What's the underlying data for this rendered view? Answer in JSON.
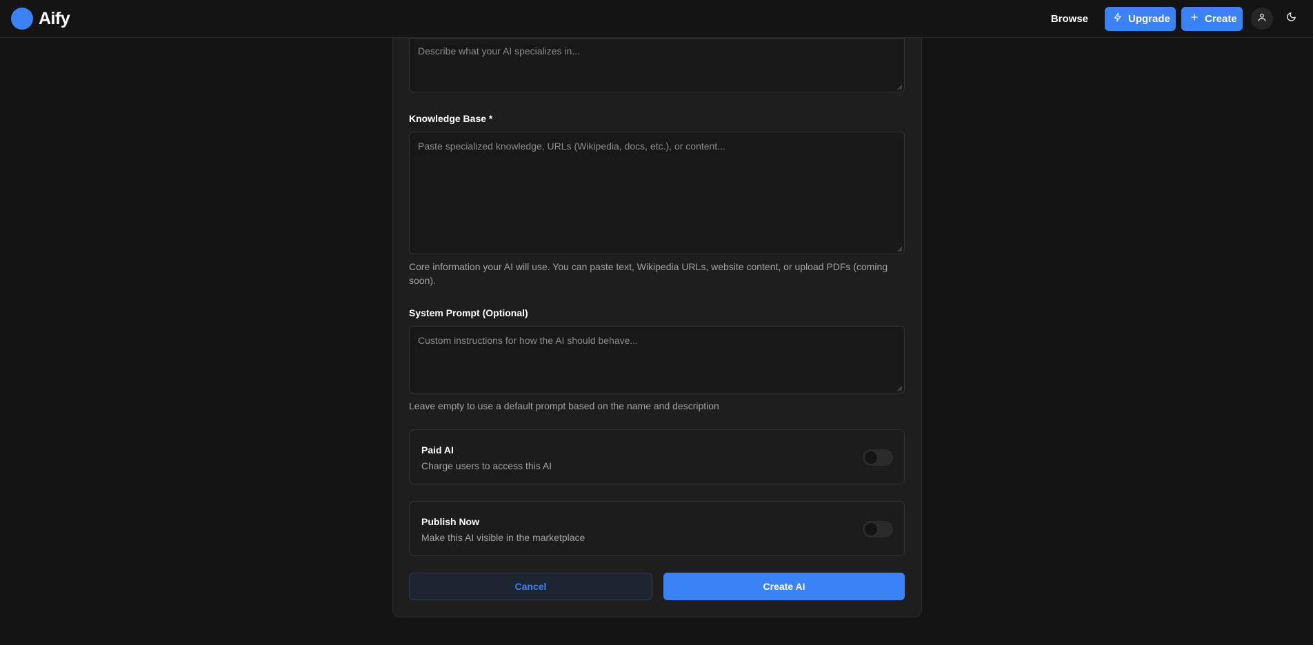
{
  "header": {
    "app_name": "Aify",
    "nav": {
      "browse_label": "Browse",
      "upgrade_label": "Upgrade",
      "create_label": "Create"
    },
    "icons": {
      "logo": "circle-logo",
      "upgrade": "lightning-icon",
      "create": "plus-icon",
      "profile": "user-icon",
      "theme": "moon-icon"
    }
  },
  "form": {
    "specialty": {
      "placeholder": "Describe what your AI specializes in..."
    },
    "knowledge_base": {
      "label": "Knowledge Base *",
      "placeholder": "Paste specialized knowledge, URLs (Wikipedia, docs, etc.), or content...",
      "help": "Core information your AI will use. You can paste text, Wikipedia URLs, website content, or upload PDFs (coming soon)."
    },
    "system_prompt": {
      "label": "System Prompt (Optional)",
      "placeholder": "Custom instructions for how the AI should behave...",
      "help": "Leave empty to use a default prompt based on the name and description"
    },
    "paid_ai": {
      "title": "Paid AI",
      "description": "Charge users to access this AI",
      "enabled": false
    },
    "publish_now": {
      "title": "Publish Now",
      "description": "Make this AI visible in the marketplace",
      "enabled": false
    },
    "actions": {
      "cancel_label": "Cancel",
      "submit_label": "Create AI"
    }
  },
  "colors": {
    "accent": "#3b82f6",
    "background": "#141414",
    "card": "#1e1e1e"
  }
}
